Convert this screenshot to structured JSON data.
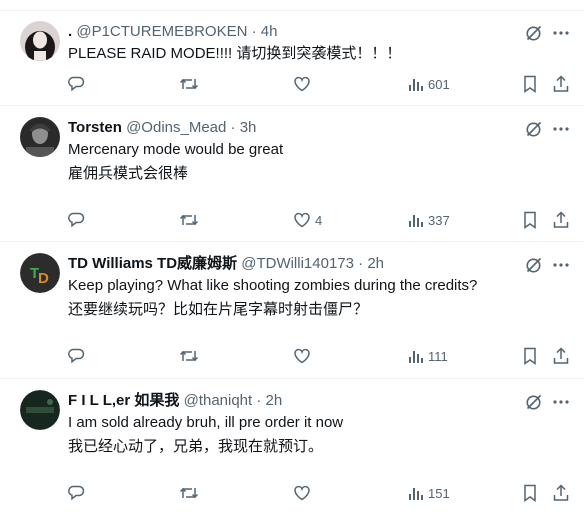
{
  "tweets": [
    {
      "name": ".",
      "handle": "@P1CTUREMEBROKEN",
      "sep": "·",
      "time": "4h",
      "lines": [
        "PLEASE RAID MODE!!!!  请切换到突袭模式！！！"
      ],
      "actions": {
        "reply": "",
        "repost": "",
        "like": "",
        "views": "601"
      },
      "avatar_icon": "photo-avatar"
    },
    {
      "name": "Torsten",
      "handle": "@Odins_Mead",
      "sep": "·",
      "time": "3h",
      "lines": [
        "Mercenary mode would be great",
        "雇佣兵模式会很棒"
      ],
      "actions": {
        "reply": "",
        "repost": "",
        "like": "4",
        "views": "337"
      },
      "avatar_icon": "photo-avatar"
    },
    {
      "name": "TD Williams TD威廉姆斯",
      "handle": "@TDWilli140173",
      "sep": "·",
      "time": "2h",
      "lines": [
        "Keep playing? What like shooting zombies during the credits?",
        "还要继续玩吗？比如在片尾字幕时射击僵尸？"
      ],
      "actions": {
        "reply": "",
        "repost": "",
        "like": "",
        "views": "111"
      },
      "avatar_icon": "td-monogram-avatar"
    },
    {
      "name": "F I L L,er 如果我",
      "handle": "@thaniqht",
      "sep": "·",
      "time": "2h",
      "lines": [
        "I am sold already bruh, ill pre order it now",
        "我已经心动了，兄弟，我现在就预订。"
      ],
      "actions": {
        "reply": "",
        "repost": "",
        "like": "",
        "views": "151"
      },
      "avatar_icon": "dark-avatar"
    }
  ],
  "colors": {
    "text": "#0f1419",
    "muted": "#536471",
    "divider": "#eff3f4"
  }
}
